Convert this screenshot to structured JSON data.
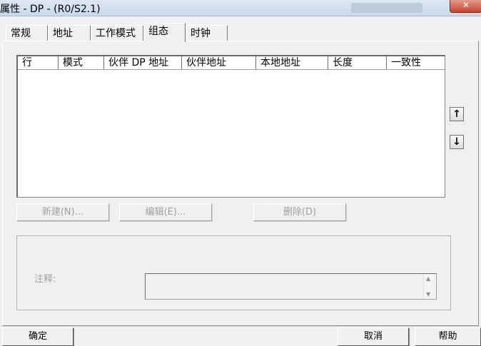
{
  "window": {
    "title": "属性 - DP - (R0/S2.1)",
    "close_glyph": "✕"
  },
  "tabs": [
    "常规",
    "地址",
    "工作模式",
    "组态",
    "时钟"
  ],
  "active_tab": "组态",
  "table": {
    "columns": [
      "行",
      "模式",
      "伙伴 DP 地址",
      "伙伴地址",
      "本地地址",
      "长度",
      "一致性"
    ],
    "rows": []
  },
  "side_buttons": {
    "up_glyph": "↑",
    "down_glyph": "↓"
  },
  "actions": {
    "new_label": "新建(N)...",
    "edit_label": "编辑(E)...",
    "delete_label": "删除(D)"
  },
  "comment": {
    "label": "注释:",
    "value": ""
  },
  "footer": {
    "ok_label": "确定",
    "cancel_label": "取消",
    "help_label": "帮助"
  }
}
